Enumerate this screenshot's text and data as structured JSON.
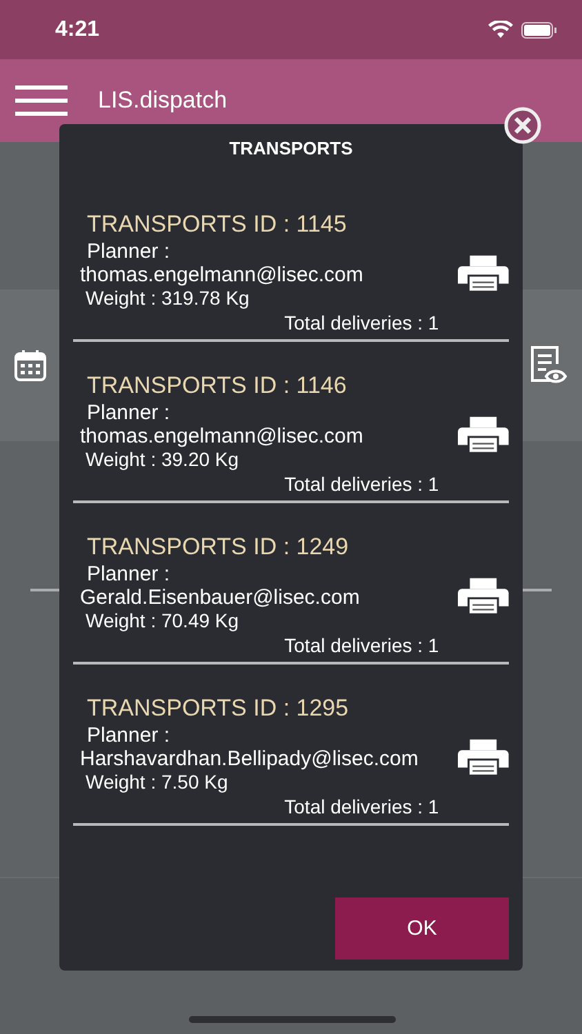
{
  "status_bar": {
    "time": "4:21"
  },
  "app_bar": {
    "title": "LIS.dispatch"
  },
  "dialog": {
    "title": "TRANSPORTS",
    "transports": [
      {
        "heading": "TRANSPORTS ID : 1145",
        "planner_label": "Planner :",
        "planner": "thomas.engelmann@lisec.com",
        "weight": "Weight : 319.78 Kg",
        "deliveries": "Total deliveries : 1"
      },
      {
        "heading": "TRANSPORTS ID : 1146",
        "planner_label": "Planner :",
        "planner": "thomas.engelmann@lisec.com",
        "weight": "Weight : 39.20 Kg",
        "deliveries": "Total deliveries : 1"
      },
      {
        "heading": "TRANSPORTS ID : 1249",
        "planner_label": "Planner :",
        "planner": "Gerald.Eisenbauer@lisec.com",
        "weight": "Weight : 70.49 Kg",
        "deliveries": "Total deliveries : 1"
      },
      {
        "heading": "TRANSPORTS ID : 1295",
        "planner_label": "Planner :",
        "planner": "Harshavardhan.Bellipady@lisec.com",
        "weight": "Weight : 7.50 Kg",
        "deliveries": "Total deliveries : 1"
      }
    ],
    "ok_button": "OK"
  }
}
